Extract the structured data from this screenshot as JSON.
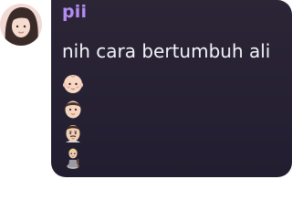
{
  "message": {
    "sender": "pii",
    "text": "nih cara bertumbuh ali",
    "emojis": [
      "baby-emoji",
      "boy-emoji",
      "man-emoji",
      "old-person-emoji"
    ]
  },
  "colors": {
    "bubble": "#2b2536",
    "sender": "#b48cf2",
    "text": "#f4f2f7"
  }
}
